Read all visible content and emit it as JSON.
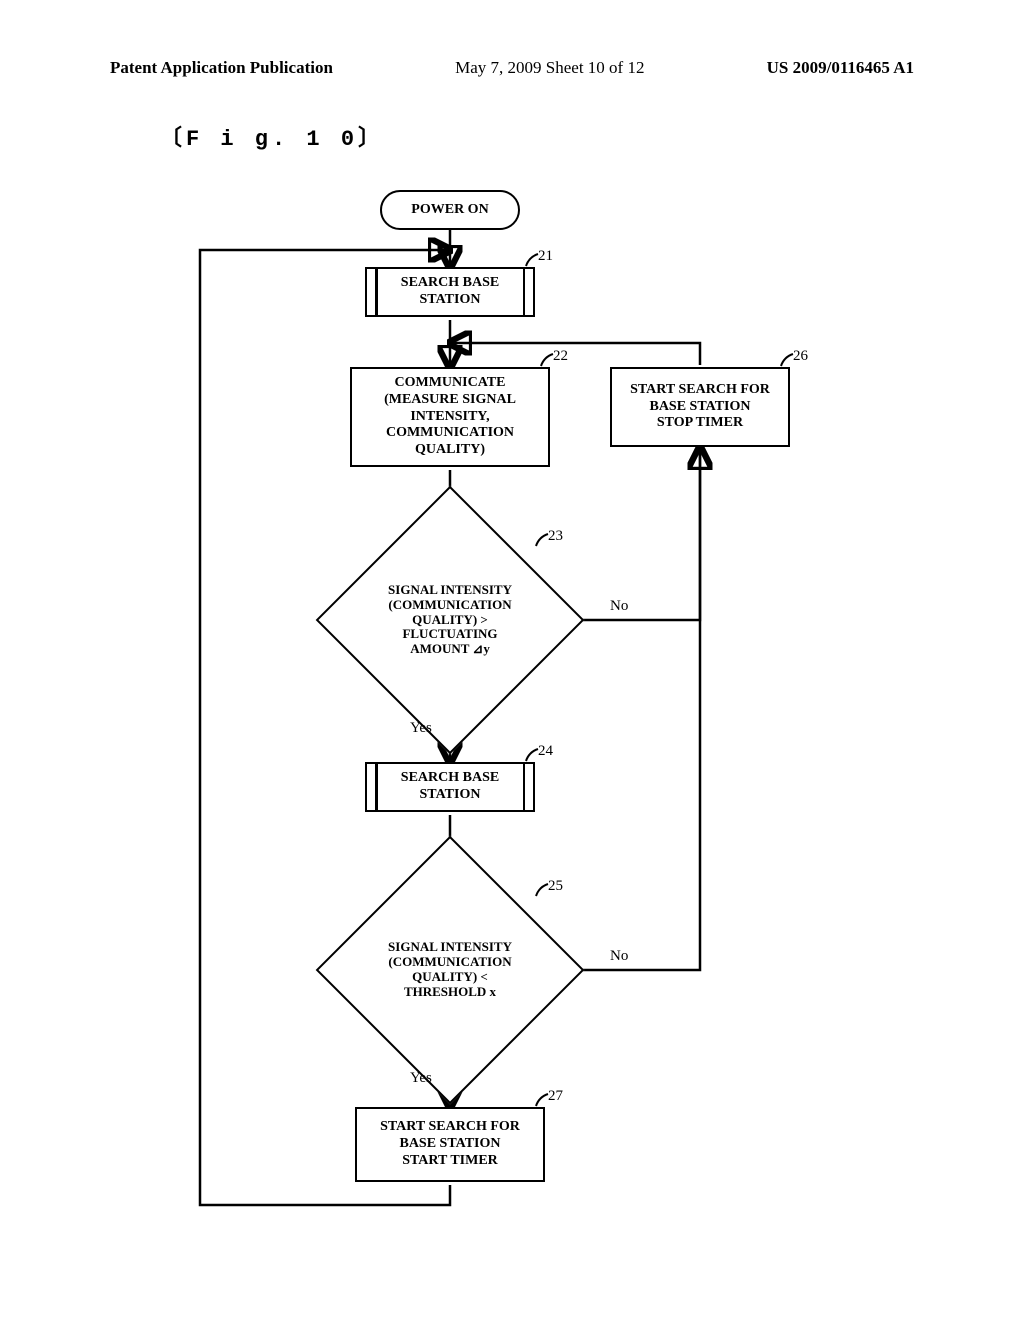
{
  "header": {
    "left": "Patent Application Publication",
    "mid": "May 7, 2009  Sheet 10 of 12",
    "right": "US 2009/0116465 A1"
  },
  "figure_label": "〔F i g. 1 0〕",
  "nodes": {
    "start": "POWER ON",
    "n21": "SEARCH BASE\nSTATION",
    "n22": "COMMUNICATE\n(MEASURE SIGNAL\nINTENSITY,\nCOMMUNICATION\nQUALITY)",
    "n23": "SIGNAL INTENSITY\n(COMMUNICATION\nQUALITY) >\nFLUCTUATING\nAMOUNT ⊿y",
    "n24": "SEARCH BASE\nSTATION",
    "n25": "SIGNAL INTENSITY\n(COMMUNICATION\nQUALITY) <\nTHRESHOLD x",
    "n26": "START SEARCH FOR\nBASE STATION\nSTOP TIMER",
    "n27": "START SEARCH FOR\nBASE STATION\nSTART TIMER"
  },
  "refs": {
    "r21": "21",
    "r22": "22",
    "r23": "23",
    "r24": "24",
    "r25": "25",
    "r26": "26",
    "r27": "27"
  },
  "labels": {
    "yes": "Yes",
    "no": "No"
  },
  "chart_data": {
    "type": "flowchart",
    "title": "Fig. 10",
    "nodes": [
      {
        "id": "start",
        "type": "terminator",
        "text": "POWER ON"
      },
      {
        "id": "21",
        "type": "subprocess",
        "text": "SEARCH BASE STATION"
      },
      {
        "id": "22",
        "type": "process",
        "text": "COMMUNICATE (MEASURE SIGNAL INTENSITY, COMMUNICATION QUALITY)"
      },
      {
        "id": "23",
        "type": "decision",
        "text": "SIGNAL INTENSITY (COMMUNICATION QUALITY) > FLUCTUATING AMOUNT ⊿y"
      },
      {
        "id": "24",
        "type": "subprocess",
        "text": "SEARCH BASE STATION"
      },
      {
        "id": "25",
        "type": "decision",
        "text": "SIGNAL INTENSITY (COMMUNICATION QUALITY) < THRESHOLD x"
      },
      {
        "id": "26",
        "type": "process",
        "text": "START SEARCH FOR BASE STATION STOP TIMER"
      },
      {
        "id": "27",
        "type": "process",
        "text": "START SEARCH FOR BASE STATION START TIMER"
      }
    ],
    "edges": [
      {
        "from": "start",
        "to": "21"
      },
      {
        "from": "21",
        "to": "22"
      },
      {
        "from": "22",
        "to": "23"
      },
      {
        "from": "23",
        "to": "24",
        "label": "Yes"
      },
      {
        "from": "23",
        "to": "26",
        "label": "No"
      },
      {
        "from": "24",
        "to": "25"
      },
      {
        "from": "25",
        "to": "27",
        "label": "Yes"
      },
      {
        "from": "25",
        "to": "26",
        "label": "No"
      },
      {
        "from": "26",
        "to": "22"
      },
      {
        "from": "27",
        "to": "21"
      }
    ]
  }
}
